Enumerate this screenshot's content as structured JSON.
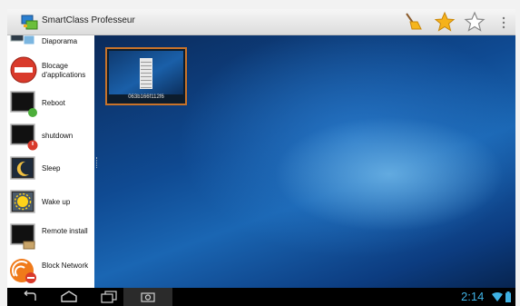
{
  "app": {
    "title": "SmartClass Professeur"
  },
  "toolbar": {
    "icons": [
      "broom-icon",
      "star-filled-icon",
      "star-outline-icon",
      "overflow-menu-icon"
    ]
  },
  "sidebar": {
    "items": [
      {
        "label": "Diaporama",
        "icon": "slideshow-icon"
      },
      {
        "label": "Blocage d'applications",
        "icon": "block-apps-icon"
      },
      {
        "label": "Reboot",
        "icon": "reboot-icon"
      },
      {
        "label": "shutdown",
        "icon": "shutdown-icon"
      },
      {
        "label": "Sleep",
        "icon": "sleep-icon"
      },
      {
        "label": "Wake up",
        "icon": "wake-up-icon"
      },
      {
        "label": "Remote install",
        "icon": "remote-install-icon"
      },
      {
        "label": "Block Network",
        "icon": "block-network-icon"
      }
    ]
  },
  "desktop": {
    "thumbnail_label": "063b166f112f6"
  },
  "status_bar": {
    "time": "2:14"
  },
  "colors": {
    "accent": "#3fb1e3",
    "thumb_border": "#c8732a",
    "block_red": "#d93a2b"
  }
}
